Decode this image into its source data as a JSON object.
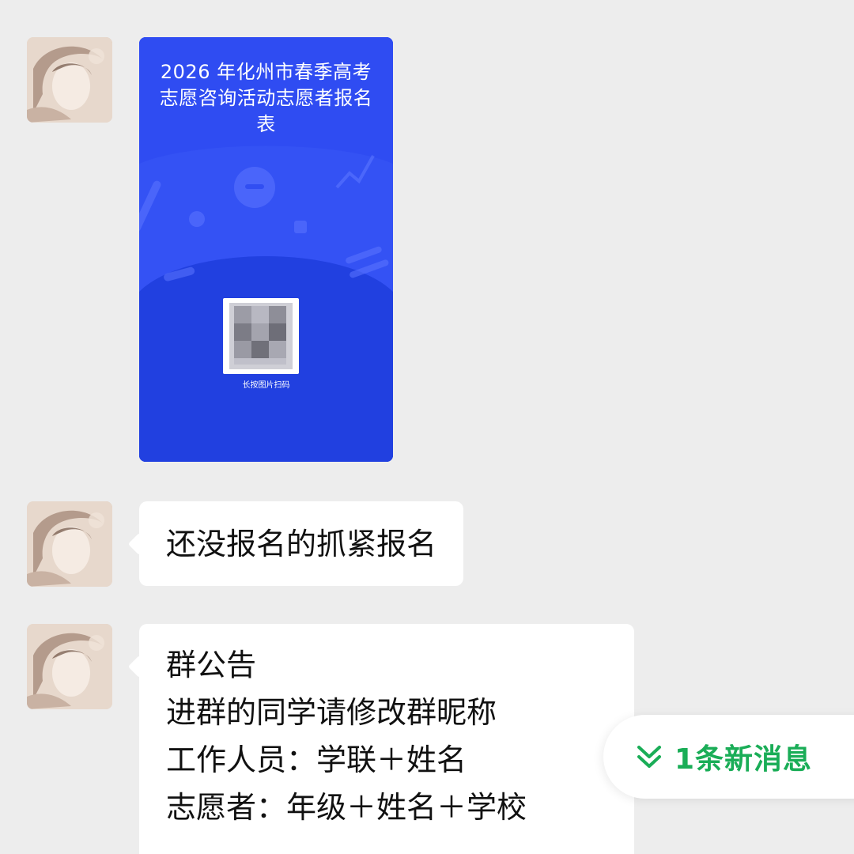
{
  "messages": {
    "first": {
      "card_title": "2026 年化州市春季高考志愿咨询活动志愿者报名表",
      "qr_caption": "长按图片扫码"
    },
    "second": {
      "text": "还没报名的抓紧报名"
    },
    "third": {
      "text": "群公告\n进群的同学请修改群昵称\n工作人员：学联＋姓名\n志愿者：年级＋姓名＋学校"
    }
  },
  "new_message_indicator": {
    "label": "1条新消息",
    "icon": "double-chevron-down-icon",
    "color": "#1aad57"
  },
  "colors": {
    "background": "#ededed",
    "card": "#2f4cf2",
    "bubble": "#ffffff"
  }
}
